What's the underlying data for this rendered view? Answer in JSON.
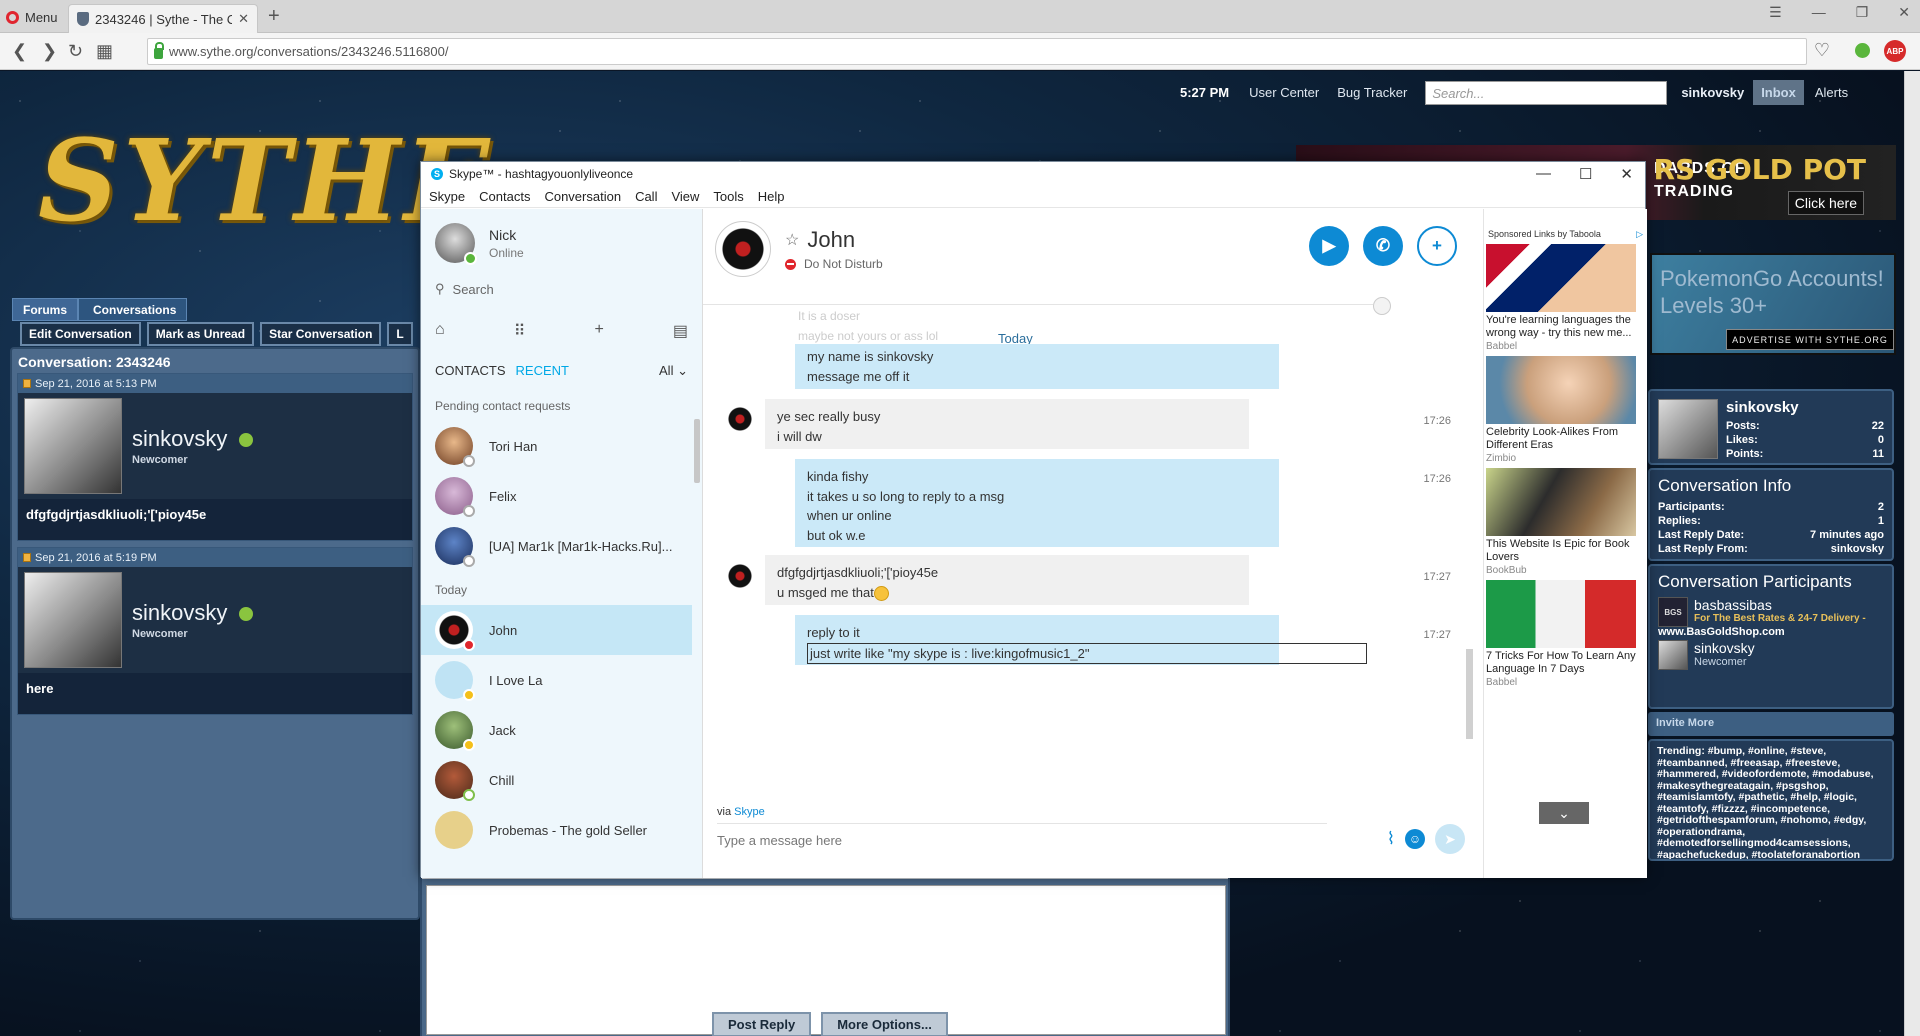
{
  "browser": {
    "menu_label": "Menu",
    "tab_title": "2343246 | Sythe - The Cra",
    "new_tab": "+",
    "url": "www.sythe.org/conversations/2343246.5116800/",
    "abp": "ABP"
  },
  "site": {
    "logo": "SYTHE",
    "clock": "5:27 PM",
    "top_links": [
      "User Center",
      "Bug Tracker"
    ],
    "search_placeholder": "Search...",
    "username": "sinkovsky",
    "inbox": "Inbox",
    "alerts": "Alerts",
    "banner": {
      "line1": "DARDS OF",
      "line2": "TRADING",
      "brand": "RS GOLD POT",
      "cta": "Click here"
    },
    "banner2_text": "PokemonGo Accounts! Levels 30+",
    "advertise": "ADVERTISE WITH SYTHE.ORG",
    "breadcrumb": [
      "Forums",
      "Conversations"
    ],
    "actions": [
      "Edit Conversation",
      "Mark as Unread",
      "Star Conversation",
      "L"
    ],
    "conversation_title": "Conversation: 2343246",
    "messages": [
      {
        "date": "Sep 21, 2016 at 5:13 PM",
        "user": "sinkovsky",
        "rank": "Newcomer",
        "body": "dfgfgdjrtjasdkliuoli;'['pioy45e"
      },
      {
        "date": "Sep 21, 2016 at 5:19 PM",
        "user": "sinkovsky",
        "rank": "Newcomer",
        "body": "here"
      }
    ],
    "profile": {
      "name": "sinkovsky",
      "posts_label": "Posts:",
      "posts": "22",
      "likes_label": "Likes:",
      "likes": "0",
      "points_label": "Points:",
      "points": "11"
    },
    "conversation_info": {
      "title": "Conversation Info",
      "rows": [
        {
          "label": "Participants:",
          "value": "2"
        },
        {
          "label": "Replies:",
          "value": "1"
        },
        {
          "label": "Last Reply Date:",
          "value": "7 minutes ago"
        },
        {
          "label": "Last Reply From:",
          "value": "sinkovsky"
        }
      ]
    },
    "participants": {
      "title": "Conversation Participants",
      "p1_name": "basbassibas",
      "p1_sub": "For The Best Rates & 24-7 Delivery -",
      "p1_url": "www.BasGoldShop.com",
      "p1_avatar": "BGS",
      "p2_name": "sinkovsky",
      "p2_sub": "Newcomer"
    },
    "invite": "Invite More",
    "trending_label": "Trending:",
    "trending": "#bump, #online, #steve, #teambanned, #freeasap, #freesteve, #hammered, #videofordemote, #modabuse, #makesythegreatagain, #psgshop, #teamislamtofy, #pathetic, #help, #logic, #teamtofy, #fizzzz, #incompetence, #getridofthespamforum, #nohomo, #edgy, #operationdrama, #demotedforsellingmod4camsessions, #apachefuckedup, #toolateforanabortion",
    "post_reply": "Post Reply",
    "more_options": "More Options..."
  },
  "skype": {
    "title": "Skype™ - hashtagyouonlyliveonce",
    "menu": [
      "Skype",
      "Contacts",
      "Conversation",
      "Call",
      "View",
      "Tools",
      "Help"
    ],
    "me": {
      "name": "Nick",
      "status": "Online"
    },
    "search_placeholder": "Search",
    "tabs": {
      "contacts": "CONTACTS",
      "recent": "RECENT",
      "filter": "All"
    },
    "pending_label": "Pending contact requests",
    "pending": [
      "Tori Han",
      "Felix",
      "[UA] Mar1k [Mar1k-Hacks.Ru]..."
    ],
    "today_label": "Today",
    "recent": [
      "John",
      "I Love La",
      "Jack",
      "Chill",
      "Probemas - The gold Seller"
    ],
    "chat": {
      "name": "John",
      "status": "Do Not Disturb",
      "faded_line1": "It is a doser",
      "faded_line2": "maybe not yours or ass lol",
      "today": "Today",
      "m1": [
        "my name is sinkovsky",
        "message me off it"
      ],
      "m2": [
        "ye sec really busy",
        "i will dw"
      ],
      "m2_time": "17:26",
      "m3": [
        "kinda fishy",
        "it takes u so long to reply to a msg",
        "when ur online",
        "but ok w.e"
      ],
      "m3_time": "17:26",
      "m4": [
        "dfgfgdjrtjasdkliuoli;'['pioy45e",
        "u msged me that"
      ],
      "m4_time": "17:27",
      "m5": [
        "reply to it",
        "just write like \"my skype is : live:kingofmusic1_2\""
      ],
      "m5_time": "17:27",
      "via": "via",
      "via_link": "Skype",
      "input_placeholder": "Type a message here"
    },
    "ads": {
      "sponsored": "Sponsored Links by Taboola",
      "items": [
        {
          "title": "You're learning languages the wrong way - try this new me...",
          "source": "Babbel"
        },
        {
          "title": "Celebrity Look-Alikes From Different Eras",
          "source": "Zimbio"
        },
        {
          "title": "This Website Is Epic for Book Lovers",
          "source": "BookBub"
        },
        {
          "title": "7 Tricks For How To Learn Any Language In 7 Days",
          "source": "Babbel"
        }
      ]
    }
  },
  "colors": {
    "skype_blue": "#0d8ad4",
    "site_blue": "#3f6796",
    "online_green": "#8ac43f",
    "dnd_red": "#e0262c"
  }
}
